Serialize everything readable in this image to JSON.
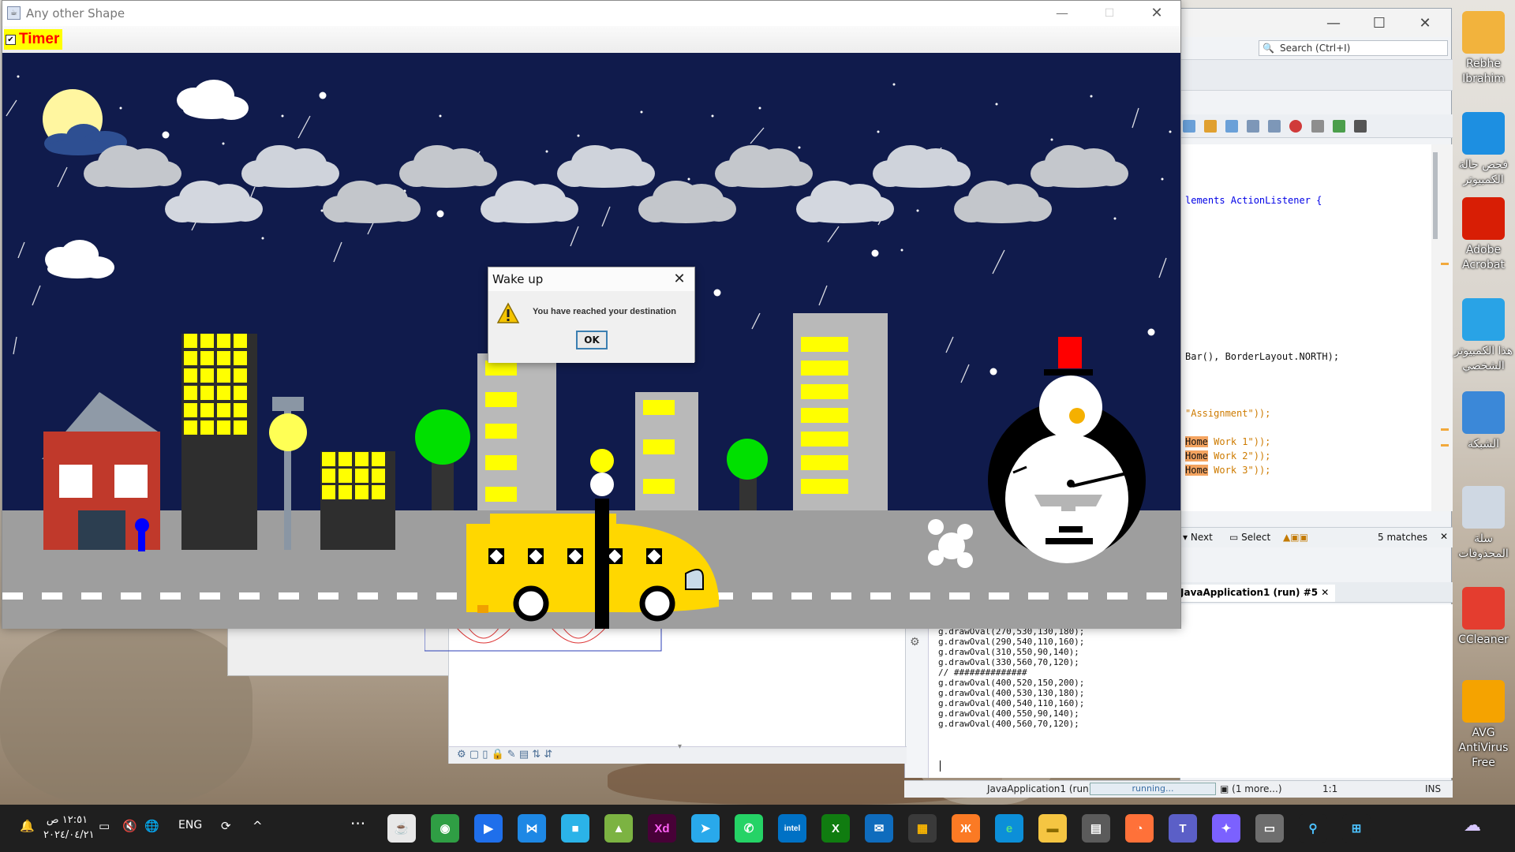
{
  "app_window": {
    "title": "Any other Shape",
    "icon": "java-cup-icon",
    "menubar": {
      "timer_checkbox_label": "Timer",
      "timer_checked": true
    }
  },
  "dialog": {
    "title": "Wake up",
    "message": "You have reached your destination",
    "ok_label": "OK",
    "icon": "warning-icon"
  },
  "ide": {
    "search_placeholder": "Search (Ctrl+I)",
    "code_lines": [
      {
        "text": "lements ActionListener {",
        "kind": "plain"
      },
      {
        "text": "Bar(), BorderLayout.NORTH);",
        "kind": "plain"
      },
      {
        "text": "\"Assignment\"));",
        "kind": "string"
      },
      {
        "text": "Home",
        "after": "Work 1\"));"
      },
      {
        "text": "Home",
        "after": "Work 2\"));"
      },
      {
        "text": "Home",
        "after": "Work 3\"));"
      }
    ],
    "find_bar": {
      "next": "Next",
      "select": "Select",
      "matches": "5 matches"
    },
    "output_tab": "JavaApplication1 (run) #5",
    "console_lines": [
      "g.drawOval(270,530,130,180);",
      "g.drawOval(290,540,110,160);",
      "g.drawOval(310,550,90,140);",
      "g.drawOval(330,560,70,120);",
      "// ##############",
      "g.drawOval(400,520,150,200);",
      "g.drawOval(400,530,130,180);",
      "g.drawOval(400,540,110,160);",
      "g.drawOval(400,550,90,140);",
      "g.drawOval(400,560,70,120);"
    ],
    "status": {
      "project": "JavaApplication1 (run)",
      "progress": "running...",
      "more": "(1 more...)",
      "position": "1:1",
      "mode": "INS"
    }
  },
  "desktop_icons": [
    {
      "label": "Rebhe\nIbrahim",
      "icon": "user-folder-icon",
      "color": "#f2b33d"
    },
    {
      "label": "فحص حالة\nالكمبيوتر",
      "icon": "pc-health-icon",
      "color": "#1d8fe1"
    },
    {
      "label": "Adobe\nAcrobat",
      "icon": "acrobat-icon",
      "color": "#d81e05"
    },
    {
      "label": "هذا الكمبيوتر\nالشخصي",
      "icon": "this-pc-icon",
      "color": "#29a3e6"
    },
    {
      "label": "الشبكة",
      "icon": "network-icon",
      "color": "#3b88d8"
    },
    {
      "label": "سلة\nالمحذوفات",
      "icon": "recycle-bin-icon",
      "color": "#cfd8e3"
    },
    {
      "label": "CCleaner",
      "icon": "ccleaner-icon",
      "color": "#e43d2f"
    },
    {
      "label": "AVG AntiVirus\nFree",
      "icon": "avg-icon",
      "color": "#f5a300"
    }
  ],
  "taskbar": {
    "clock_time": "١٢:٥١ ص",
    "clock_date": "٢٠٢٤/٠٤/٢١",
    "language": "ENG",
    "apps": [
      {
        "name": "java-app-icon",
        "label": "☕",
        "color": "#e8e8e8",
        "fg": "#c33"
      },
      {
        "name": "chrome-icon",
        "label": "◉",
        "color": "#2f9e44",
        "fg": "#fff"
      },
      {
        "name": "video-player-icon",
        "label": "▶",
        "color": "#1f6feb",
        "fg": "#fff"
      },
      {
        "name": "vscode-icon",
        "label": "⋈",
        "color": "#1e88e5",
        "fg": "#fff"
      },
      {
        "name": "cube-app-icon",
        "label": "■",
        "color": "#2bb3e8",
        "fg": "#fff"
      },
      {
        "name": "matlab-icon",
        "label": "▲",
        "color": "#7cb342",
        "fg": "#fff"
      },
      {
        "name": "adobe-xd-icon",
        "label": "Xd",
        "color": "#470137",
        "fg": "#ff61f6"
      },
      {
        "name": "telegram-icon",
        "label": "➤",
        "color": "#29a9eb",
        "fg": "#fff"
      },
      {
        "name": "whatsapp-icon",
        "label": "✆",
        "color": "#25d366",
        "fg": "#fff"
      },
      {
        "name": "intel-icon",
        "label": "intel",
        "color": "#0071c5",
        "fg": "#fff"
      },
      {
        "name": "xbox-icon",
        "label": "X",
        "color": "#107c10",
        "fg": "#fff"
      },
      {
        "name": "mail-icon",
        "label": "✉",
        "color": "#0f6cbd",
        "fg": "#fff"
      },
      {
        "name": "store-icon",
        "label": "▦",
        "color": "#3a3a3a",
        "fg": "#ffb900"
      },
      {
        "name": "xampp-icon",
        "label": "Ж",
        "color": "#fb7a24",
        "fg": "#fff"
      },
      {
        "name": "edge-icon",
        "label": "e",
        "color": "#0c8fd8",
        "fg": "#4fe08a"
      },
      {
        "name": "file-explorer-icon",
        "label": "▬",
        "color": "#f5c542",
        "fg": "#8a6b00"
      },
      {
        "name": "calculator-icon",
        "label": "▤",
        "color": "#5b5b5b",
        "fg": "#fff"
      },
      {
        "name": "firefox-icon",
        "label": "◔",
        "color": "#ff7139",
        "fg": "#fff"
      },
      {
        "name": "teams-icon",
        "label": "T",
        "color": "#5b5fc7",
        "fg": "#fff"
      },
      {
        "name": "copilot-icon",
        "label": "✦",
        "color": "#7b61ff",
        "fg": "#fff"
      },
      {
        "name": "multitask-icon",
        "label": "▭",
        "color": "#6e6e6e",
        "fg": "#fff"
      },
      {
        "name": "search-taskbar-icon",
        "label": "⚲",
        "color": "#1f1f1f",
        "fg": "#4cc2ff"
      },
      {
        "name": "start-icon",
        "label": "⊞",
        "color": "#1f1f1f",
        "fg": "#4cc2ff"
      }
    ]
  }
}
